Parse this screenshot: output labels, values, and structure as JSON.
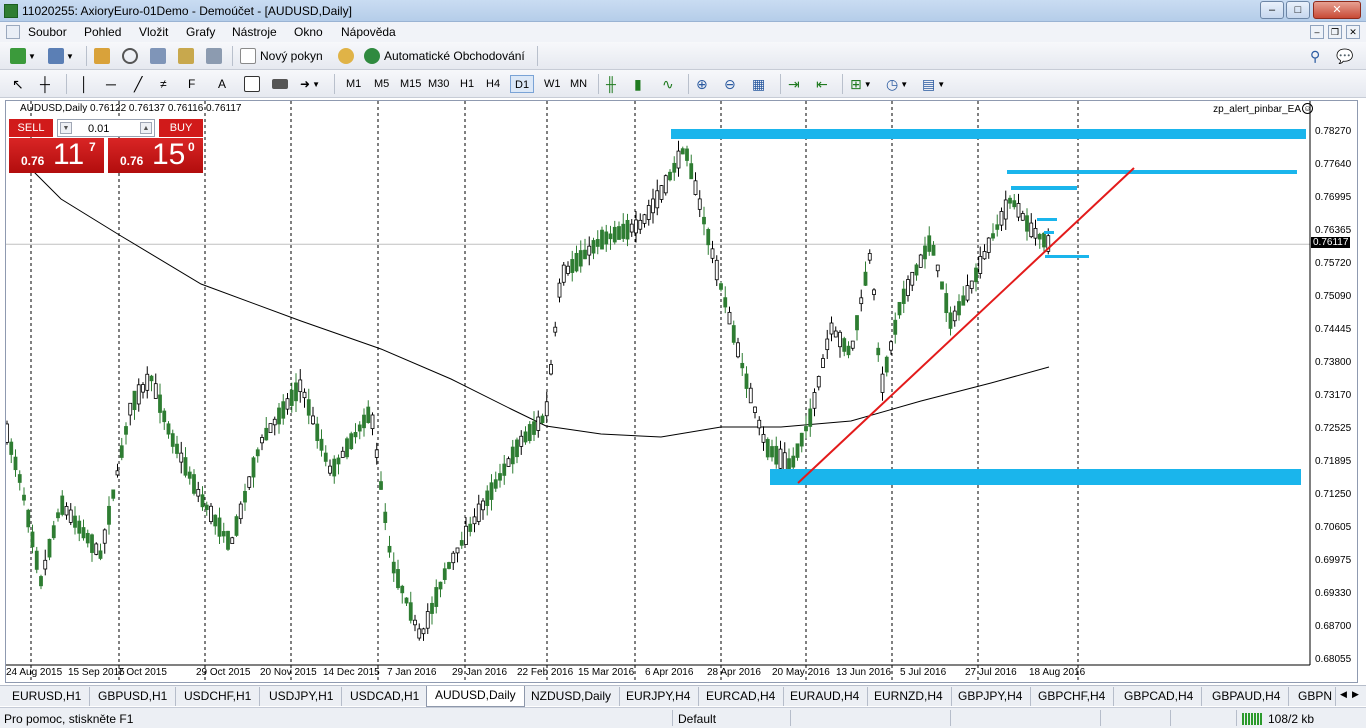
{
  "window": {
    "title": "11020255: AxioryEuro-01Demo - Demoúčet - [AUDUSD,Daily]",
    "buttons": [
      "–",
      "□",
      "✕"
    ]
  },
  "menu": {
    "items": [
      "Soubor",
      "Pohled",
      "Vložit",
      "Grafy",
      "Nástroje",
      "Okno",
      "Nápověda"
    ]
  },
  "toolbar": {
    "new_order_label": "Nový pokyn",
    "auto_trading_label": "Automatické Obchodování",
    "timeframes": [
      "M1",
      "M5",
      "M15",
      "M30",
      "H1",
      "H4",
      "D1",
      "W1",
      "MN"
    ],
    "active_timeframe": "D1"
  },
  "chart": {
    "symbol_line": "AUDUSD,Daily  0.76122 0.76137 0.76116 0.76117",
    "ea_label": "zp_alert_pinbar_EA",
    "ea_icon": "smiley-icon",
    "current_price": "0.76117",
    "price_labels": [
      "0.78270",
      "0.77640",
      "0.76995",
      "0.76365",
      "0.75720",
      "0.75090",
      "0.74445",
      "0.73800",
      "0.73170",
      "0.72525",
      "0.71895",
      "0.71250",
      "0.70605",
      "0.69975",
      "0.69330",
      "0.68700",
      "0.68055"
    ],
    "date_labels": [
      "24 Aug 2015",
      "15 Sep 2015",
      "7 Oct 2015",
      "29 Oct 2015",
      "20 Nov 2015",
      "14 Dec 2015",
      "7 Jan 2016",
      "29 Jan 2016",
      "22 Feb 2016",
      "15 Mar 2016",
      "6 Apr 2016",
      "28 Apr 2016",
      "20 May 2016",
      "13 Jun 2016",
      "5 Jul 2016",
      "27 Jul 2016",
      "18 Aug 2016"
    ],
    "colors": {
      "bull": "#2e7d32",
      "bear": "#000000",
      "zone": "#1ab5ec",
      "trendline": "#e31b1b",
      "ma": "#000000"
    }
  },
  "trade_panel": {
    "sell_label": "SELL",
    "buy_label": "BUY",
    "lot": "0.01",
    "sell_prefix": "0.76",
    "sell_big": "11",
    "sell_sup": "7",
    "buy_prefix": "0.76",
    "buy_big": "15",
    "buy_sup": "0"
  },
  "tabs": {
    "items": [
      "EURUSD,H1",
      "GBPUSD,H1",
      "USDCHF,H1",
      "USDJPY,H1",
      "USDCAD,H1",
      "AUDUSD,Daily",
      "NZDUSD,Daily",
      "EURJPY,H4",
      "EURCAD,H4",
      "EURAUD,H4",
      "EURNZD,H4",
      "GBPJPY,H4",
      "GBPCHF,H4",
      "GBPCAD,H4",
      "GBPAUD,H4",
      "GBPN"
    ],
    "active": "AUDUSD,Daily"
  },
  "status": {
    "help": "Pro pomoc, stiskněte F1",
    "profile": "Default",
    "traffic": "108/2 kb"
  }
}
